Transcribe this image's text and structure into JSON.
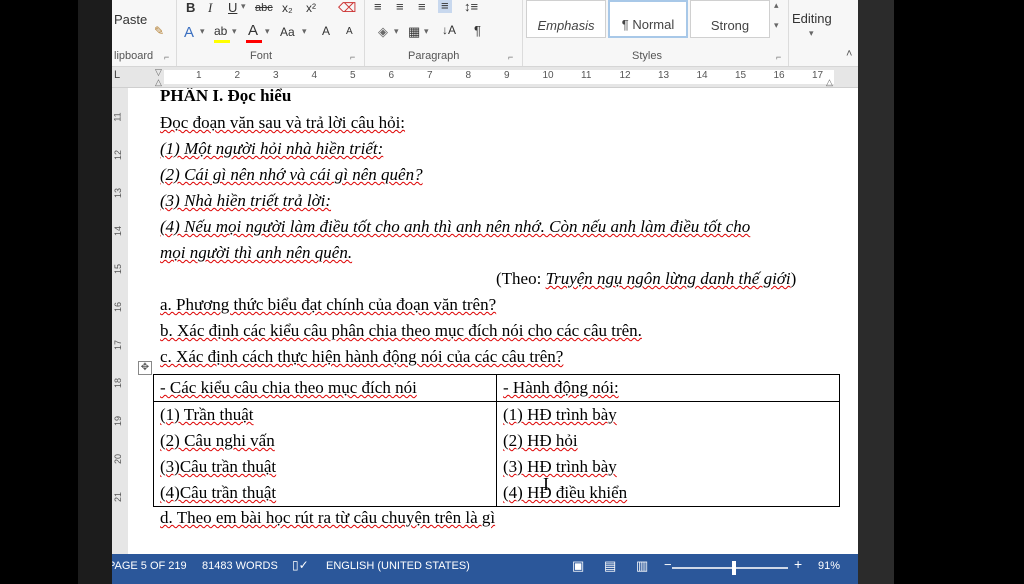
{
  "ribbon": {
    "paste_label": "Paste",
    "clipboard_label": "lipboard",
    "font_label": "Font",
    "paragraph_label": "Paragraph",
    "styles_label": "Styles",
    "editing_label": "Editing",
    "styles": [
      {
        "name": "Emphasis"
      },
      {
        "name": "¶ Normal"
      },
      {
        "name": "Strong"
      }
    ],
    "font_buttons": {
      "bold": "B",
      "italic": "I",
      "underline": "U",
      "strike": "abc",
      "subscript": "x₂",
      "superscript": "x²",
      "text_effect": "A",
      "highlight": "ab",
      "font_color": "A",
      "change_case": "Aa",
      "grow": "A",
      "shrink": "A"
    },
    "accent_colors": {
      "highlight": "#ffff00",
      "font_color": "#ff0000"
    }
  },
  "ruler": {
    "ticks": [
      "1",
      "2",
      "3",
      "4",
      "5",
      "6",
      "7",
      "8",
      "9",
      "10",
      "11",
      "12",
      "13",
      "14",
      "15",
      "16",
      "17"
    ],
    "vertical_ticks": [
      "11",
      "12",
      "13",
      "14",
      "15",
      "16",
      "17",
      "18",
      "19",
      "20",
      "21"
    ]
  },
  "document": {
    "heading": "PHẦN I. Đọc hiểu",
    "intro": "Đọc đoạn văn sau và trả lời câu hỏi:",
    "lines": [
      "(1) Một người hỏi nhà hiền triết:",
      "(2) Cái gì nên nhớ và cái gì nên quên?",
      "(3) Nhà hiền triết trả lời:",
      "(4) Nếu mọi người làm điều tốt cho anh thì anh nên nhớ. Còn nếu anh làm điều tốt cho",
      "mọi người thì anh nên quên."
    ],
    "source_prefix": "(Theo: ",
    "source_title": "Truyện ngụ ngôn lừng danh thế giới",
    "source_suffix": ")",
    "questions": [
      "a. Phương thức biểu đạt chính của đoạn văn trên?",
      "b. Xác định các kiểu câu phân chia theo mục đích nói cho các câu trên.",
      "c. Xác định cách thực hiện hành động nói của các câu trên?"
    ],
    "table": {
      "headers": [
        "- Các kiểu câu chia theo mục đích nói",
        "- Hành động nói:"
      ],
      "col1": [
        "(1) Trần thuật",
        "(2) Câu nghi vấn",
        "(3)Câu trần thuật",
        "(4)Câu trần thuật"
      ],
      "col2": [
        "(1) HĐ trình bày",
        "(2) HĐ hỏi",
        "(3) HĐ trình bày",
        "(4) HĐ điều khiển"
      ]
    },
    "question_d": "d. Theo em bài học rút ra từ câu chuyện trên là gì"
  },
  "status": {
    "page": "PAGE 5 OF 219",
    "words": "81483 WORDS",
    "language": "ENGLISH (UNITED STATES)",
    "zoom": "91%",
    "zoom_minus": "−",
    "zoom_plus": "+"
  }
}
